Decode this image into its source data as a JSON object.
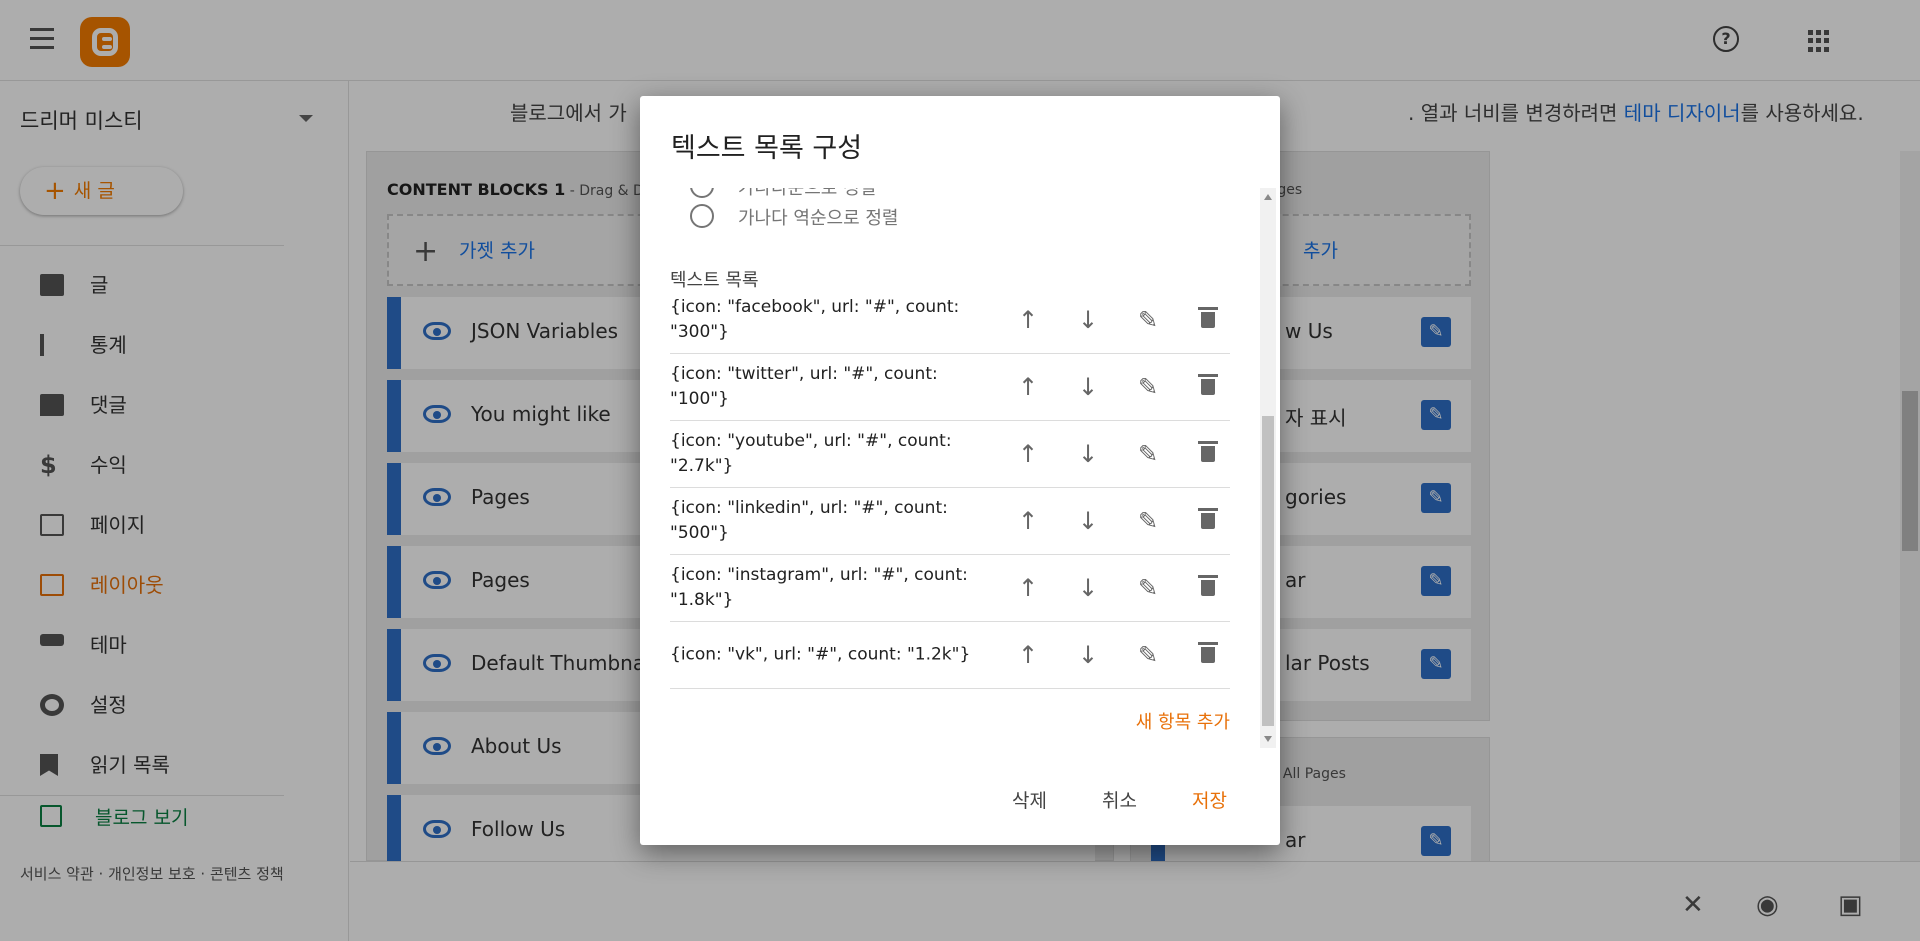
{
  "sidebar": {
    "blog_name": "드리머 미스티",
    "new_post_label": "새 글",
    "items": [
      {
        "label": "글",
        "icon": "document-icon"
      },
      {
        "label": "통계",
        "icon": "stats-icon"
      },
      {
        "label": "댓글",
        "icon": "comment-icon"
      },
      {
        "label": "수익",
        "icon": "dollar-icon"
      },
      {
        "label": "페이지",
        "icon": "pages-icon"
      },
      {
        "label": "레이아웃",
        "icon": "layout-icon"
      },
      {
        "label": "테마",
        "icon": "theme-icon"
      },
      {
        "label": "설정",
        "icon": "gear-icon"
      },
      {
        "label": "읽기 목록",
        "icon": "bookmark-icon"
      }
    ],
    "view_blog": "블로그 보기",
    "footer": "서비스 약관 · 개인정보 보호 · 콘텐츠 정책"
  },
  "main": {
    "notice_left": "블로그에서 가",
    "notice_right": ". 열과 너비를 변경하려면 ",
    "notice_link": "테마 디자이너",
    "notice_end": "를 사용하세요.",
    "left_col_title": "CONTENT BLOCKS 1",
    "left_col_sub": " - Drag & Drop",
    "add_gadget": "가젯 추가",
    "right_add_gadget": "추가",
    "left_gadgets": [
      "JSON Variables",
      "You might like",
      "Pages",
      "Pages",
      "Default Thumbnail",
      "About Us",
      "Follow Us"
    ],
    "right_col_title": "Pages",
    "right_col2_title": "on All Pages",
    "right_gadgets": [
      "w Us",
      "자 표시",
      "gories",
      "ar",
      "lar Posts"
    ],
    "right_gadget2": "ar"
  },
  "dialog": {
    "title": "텍스트 목록 구성",
    "radio_partial": "가나다순으로 정렬",
    "radio_reverse": "가나다 역순으로 정렬",
    "list_label": "텍스트 목록",
    "items": [
      "{icon: \"facebook\", url: \"#\", count: \"300\"}",
      "{icon: \"twitter\", url: \"#\", count: \"100\"}",
      "{icon: \"youtube\", url: \"#\", count: \"2.7k\"}",
      "{icon: \"linkedin\", url: \"#\", count: \"500\"}",
      "{icon: \"instagram\", url: \"#\", count: \"1.8k\"}",
      "{icon: \"vk\", url: \"#\", count: \"1.2k\"}"
    ],
    "add_item": "새 항목 추가",
    "delete_label": "삭제",
    "cancel_label": "취소",
    "save_label": "저장"
  },
  "colors": {
    "accent": "#e8710a",
    "blogger_orange": "#f57d00",
    "gadget_blue": "#2e6fc7",
    "link_blue": "#1a73e8"
  }
}
